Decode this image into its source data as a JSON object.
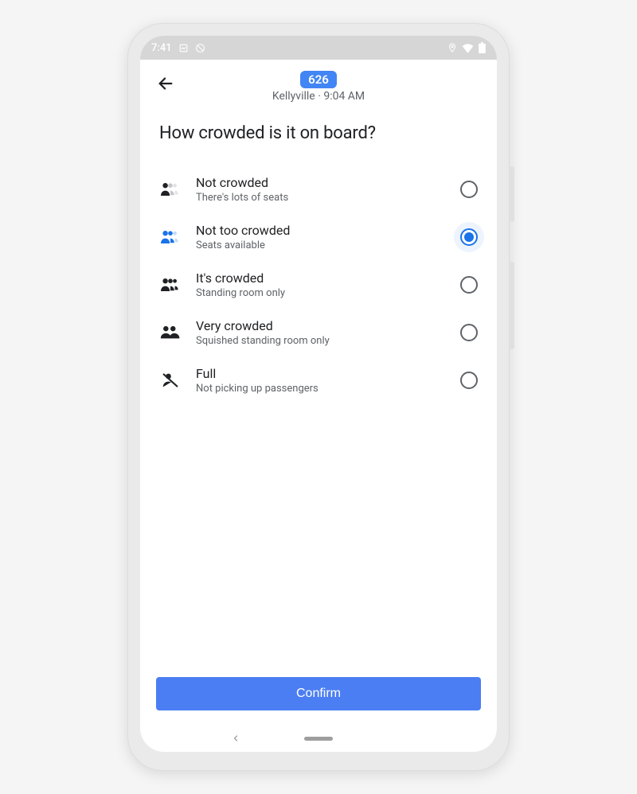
{
  "statusbar": {
    "time": "7:41"
  },
  "header": {
    "route_number": "626",
    "subtitle": "Kellyville · 9:04 AM"
  },
  "question": "How crowded is it on board?",
  "options": [
    {
      "id": "not-crowded",
      "title": "Not crowded",
      "subtitle": "There's lots of seats",
      "selected": false,
      "icon": "person1"
    },
    {
      "id": "not-too-crowded",
      "title": "Not too crowded",
      "subtitle": "Seats available",
      "selected": true,
      "icon": "person2"
    },
    {
      "id": "its-crowded",
      "title": "It's crowded",
      "subtitle": "Standing room only",
      "selected": false,
      "icon": "person3"
    },
    {
      "id": "very-crowded",
      "title": "Very crowded",
      "subtitle": "Squished standing room only",
      "selected": false,
      "icon": "group"
    },
    {
      "id": "full",
      "title": "Full",
      "subtitle": "Not picking up passengers",
      "selected": false,
      "icon": "noentry"
    }
  ],
  "confirm_label": "Confirm"
}
